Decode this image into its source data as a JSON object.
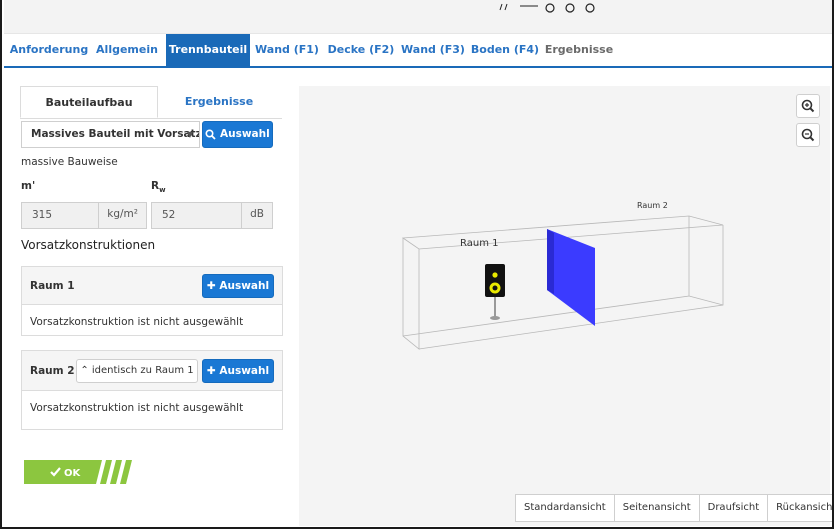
{
  "nav": {
    "tabs": [
      {
        "label": "Anforderung"
      },
      {
        "label": "Allgemein"
      },
      {
        "label": "Trennbauteil"
      },
      {
        "label": "Wand (F1)"
      },
      {
        "label": "Decke (F2)"
      },
      {
        "label": "Wand (F3)"
      },
      {
        "label": "Boden (F4)"
      },
      {
        "label": "Ergebnisse"
      }
    ],
    "active_index": 2
  },
  "left": {
    "subtabs": [
      {
        "label": "Bauteilaufbau"
      },
      {
        "label": "Ergebnisse"
      }
    ],
    "select_value": "Massives Bauteil mit Vorsatzkc",
    "auswahl_label": "Auswahl",
    "construction_note": "massive Bauweise",
    "mass_label": "m'",
    "rw_label_main": "R",
    "rw_label_sub": "w",
    "mass_value": "315",
    "mass_unit": "kg/m²",
    "rw_value": "52",
    "rw_unit": "dB",
    "vorsatz_heading": "Vorsatzkonstruktionen",
    "raum1": {
      "label": "Raum 1",
      "button": "Auswahl",
      "status": "Vorsatzkonstruktion ist nicht ausgewählt"
    },
    "raum2": {
      "label": "Raum 2",
      "identical_label": "identisch zu Raum 1",
      "button": "Auswahl",
      "status": "Vorsatzkonstruktion ist nicht ausgewählt"
    },
    "ok_label": "OK"
  },
  "viewport": {
    "room1_label": "Raum 1",
    "room2_label": "Raum 2",
    "view_buttons": [
      {
        "label": "Standardansicht"
      },
      {
        "label": "Seitenansicht"
      },
      {
        "label": "Draufsicht"
      },
      {
        "label": "Rückansicht"
      }
    ]
  },
  "colors": {
    "primary": "#1a78d4",
    "nav_active": "#1a6ab8",
    "ok_green": "#8cc63f",
    "partition": "#3b3bff",
    "speaker_cone": "#e8e800"
  }
}
